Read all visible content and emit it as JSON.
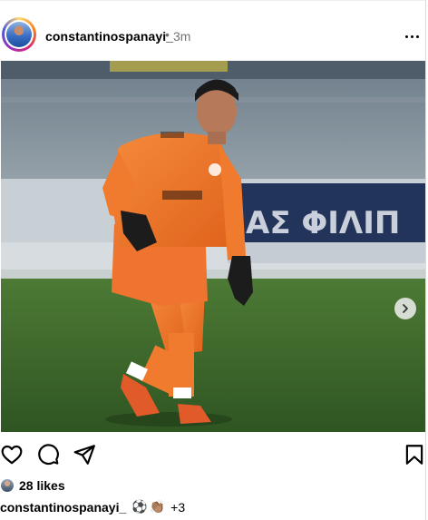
{
  "post": {
    "username": "constantinospanayi_",
    "separator": "•",
    "time": "3m",
    "likes": "28 likes",
    "caption_user": "constantinospanayi_",
    "caption_emojis": [
      "⚽",
      "👏🏽"
    ],
    "caption_more": "+3",
    "carousel": {
      "slides": 3,
      "active": 1
    }
  },
  "icons": {
    "more": "more-horizontal-icon",
    "like": "heart-icon",
    "comment": "comment-icon",
    "share": "send-icon",
    "save": "bookmark-icon",
    "next": "chevron-right-icon",
    "tag": "user-tag-icon"
  },
  "colors": {
    "kit_orange": "#f07a2e",
    "pitch_green": "#3f6a2c",
    "secondary_text": "#737373"
  }
}
